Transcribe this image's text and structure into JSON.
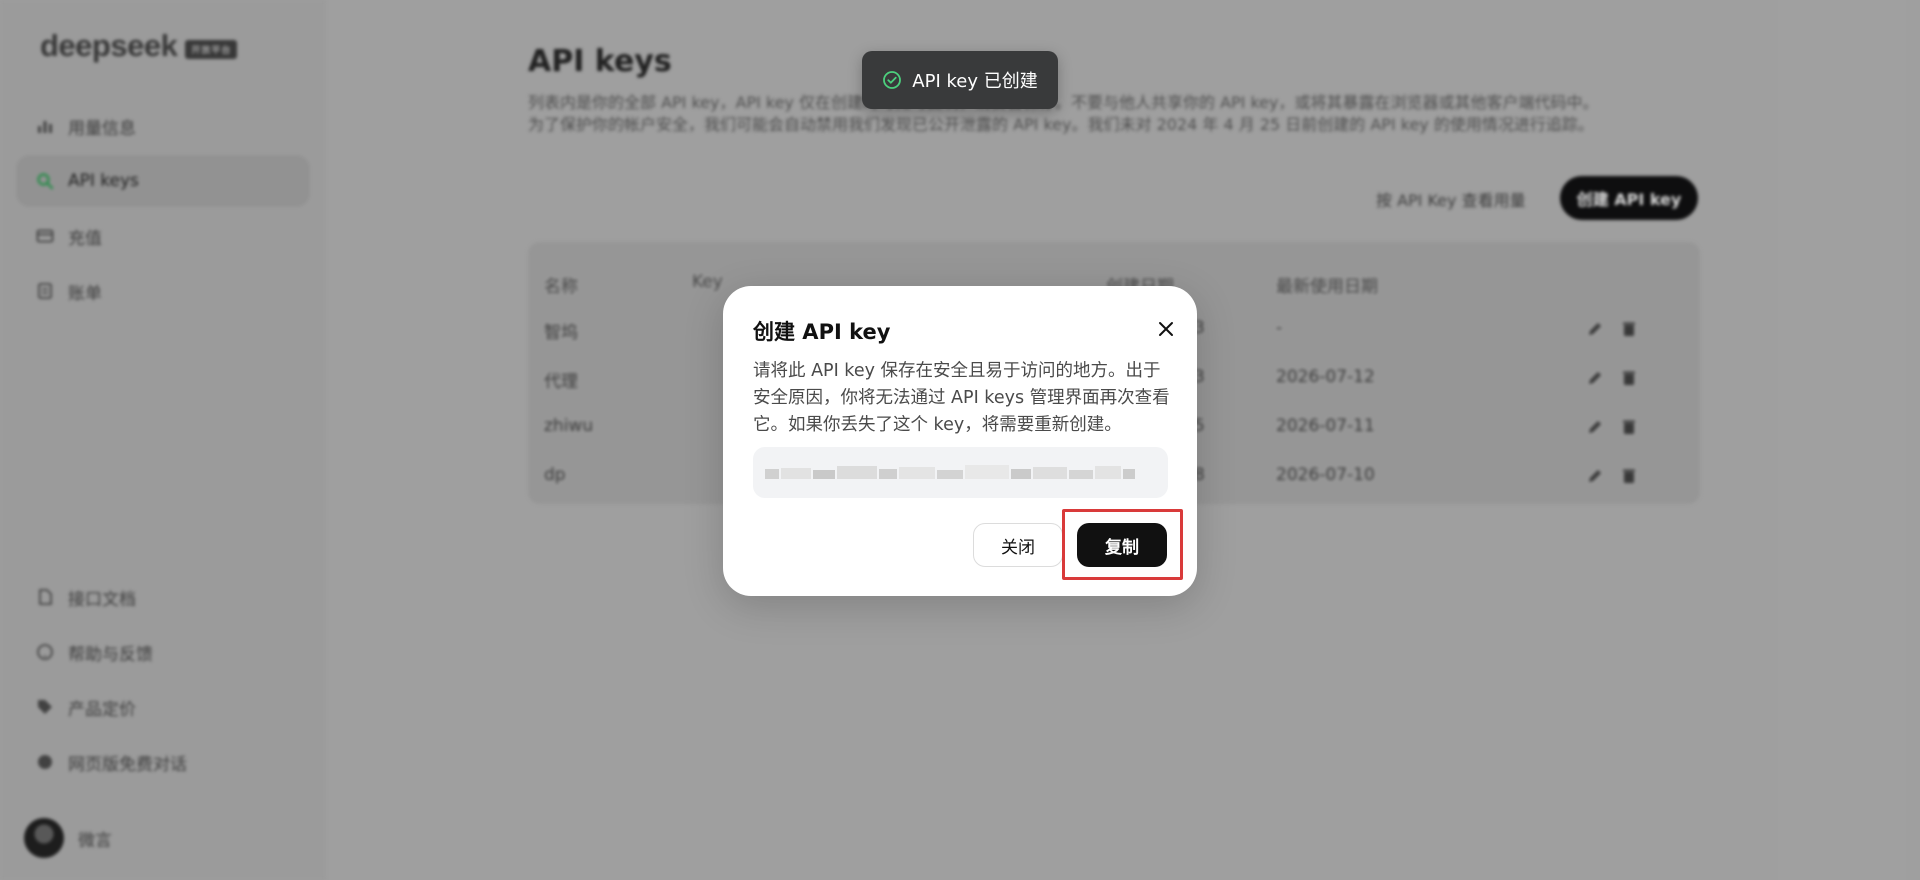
{
  "sidebar": {
    "logo": "deepseek",
    "logo_tag": "开放平台",
    "nav_top": [
      {
        "label": "用量信息",
        "icon": "bar-chart-icon"
      },
      {
        "label": "API keys",
        "icon": "search-icon",
        "active": true
      },
      {
        "label": "充值",
        "icon": "card-icon"
      },
      {
        "label": "账单",
        "icon": "bill-icon"
      }
    ],
    "nav_bottom": [
      {
        "label": "接口文档",
        "icon": "doc-icon"
      },
      {
        "label": "帮助与反馈",
        "icon": "help-icon"
      },
      {
        "label": "产品定价",
        "icon": "tag-icon"
      },
      {
        "label": "网页版免费对话",
        "icon": "chat-icon"
      }
    ],
    "user_name": "微言"
  },
  "main": {
    "title": "API keys",
    "desc_line1": "列表内是你的全部 API key，API key 仅在创建时可见可复制，请妥善保存。不要与他人共享你的 API key，或将其暴露在浏览器或其他客户端代码中。",
    "desc_line2": "为了保护你的帐户安全，我们可能会自动禁用我们发现已公开泄露的 API key。我们未对 2024 年 4 月 25 日前创建的 API key 的使用情况进行追踪。",
    "usage_button": "按 API Key 查看用量",
    "create_button": "创建 API key",
    "table": {
      "headers": [
        "名称",
        "Key",
        "创建日期",
        "最新使用日期"
      ],
      "rows": [
        {
          "name": "智坞",
          "created": "2026-07-13",
          "last_used": "-"
        },
        {
          "name": "代理",
          "created": "2026-07-03",
          "last_used": "2026-07-12"
        },
        {
          "name": "zhiwu",
          "created": "2026-06-05",
          "last_used": "2026-07-11"
        },
        {
          "name": "dp",
          "created": "2025-09-18",
          "last_used": "2026-07-10"
        }
      ]
    }
  },
  "toast": {
    "text": "API key 已创建",
    "icon": "check-circle-icon",
    "icon_color": "#4cd07d"
  },
  "dialog": {
    "title": "创建 API key",
    "body_line1": "请将此 API key 保存在安全且易于访问的地方。出于",
    "body_line2": "安全原因，你将无法通过 API keys 管理界面再次查看",
    "body_line3": "它。如果你丢失了这个 key，将需要重新创建。",
    "close_label": "关闭",
    "copy_label": "复制"
  },
  "colors": {
    "accent": "#111111",
    "highlight": "#d93a3a",
    "active_nav_icon": "#3aa55c"
  }
}
